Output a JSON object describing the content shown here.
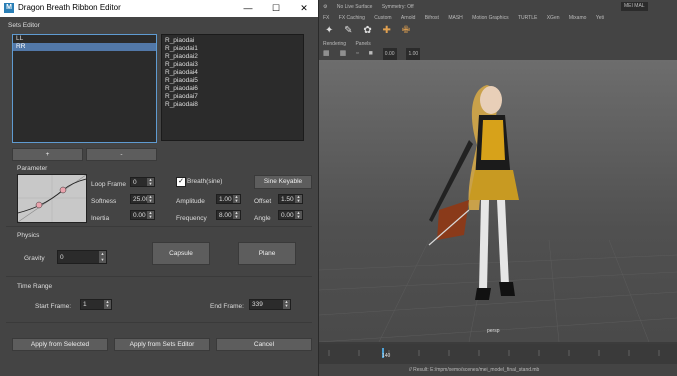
{
  "window": {
    "title": "Dragon Breath Ribbon Editor",
    "app_icon": "M"
  },
  "sets_editor": {
    "label": "Sets Editor",
    "sets": [
      "LL",
      "RR"
    ],
    "selected_set": 1,
    "members": [
      "R_piaodai",
      "R_piaodai1",
      "R_piaodai2",
      "R_piaodai3",
      "R_piaodai4",
      "R_piaodai5",
      "R_piaodai6",
      "R_piaodai7",
      "R_piaodai8"
    ],
    "add_label": "+",
    "remove_label": "-"
  },
  "parameter": {
    "label": "Parameter",
    "loop_frame": {
      "label": "Loop Frame",
      "value": "0"
    },
    "softness": {
      "label": "Softness",
      "value": "25.00"
    },
    "inertia": {
      "label": "Inertia",
      "value": "0.00"
    },
    "breath": {
      "label": "Breath(sine)",
      "checked": true
    },
    "sine_keyable_label": "Sine Keyable",
    "amplitude": {
      "label": "Amplitude",
      "value": "1.00"
    },
    "offset": {
      "label": "Offset",
      "value": "1.50"
    },
    "frequency": {
      "label": "Frequency",
      "value": "8.00"
    },
    "angle": {
      "label": "Angle",
      "value": "0.00"
    }
  },
  "physics": {
    "label": "Physics",
    "gravity": {
      "label": "Gravity",
      "value": "0"
    },
    "capsule_label": "Capsule",
    "plane_label": "Plane"
  },
  "time_range": {
    "label": "Time Range",
    "start": {
      "label": "Start Frame:",
      "value": "1"
    },
    "end": {
      "label": "End Frame:",
      "value": "339"
    }
  },
  "actions": {
    "apply_selected": "Apply from Selected",
    "apply_sets": "Apply from Sets Editor",
    "cancel": "Cancel"
  },
  "maya": {
    "status_line": "// Result: E:/mpm/xemo/scenes/mei_model_final_stand.mb",
    "live_surface": "No Live Surface",
    "symmetry": "Symmetry: Off",
    "workspace": "MEI MAL",
    "menus": [
      "Rendering",
      "Panels"
    ],
    "shelf_tabs": [
      "FX",
      "FX Caching",
      "Custom",
      "Arnold",
      "Bifrost",
      "MASH",
      "Motion Graphics",
      "TURTLE",
      "XGen",
      "Mixamo",
      "Yeti"
    ],
    "camera_value_1": "0.00",
    "camera_value_2": "1.00",
    "timeline_frame": "140",
    "character_label": "persp"
  },
  "colors": {
    "accent": "#5278a8",
    "title_bar": "#ffffff",
    "panel": "#444444"
  }
}
